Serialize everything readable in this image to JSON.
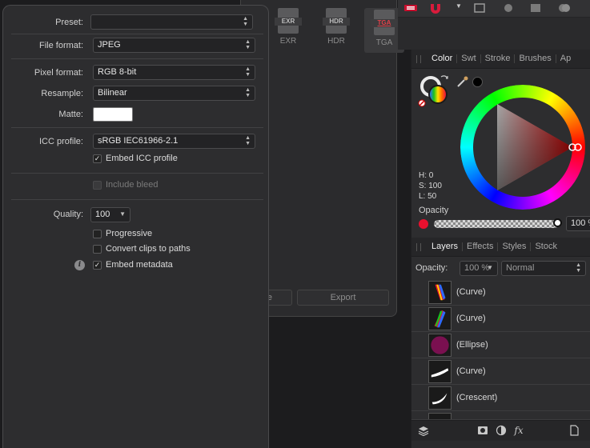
{
  "bg_dialog": {
    "formats": [
      "EXR",
      "HDR",
      "TGA"
    ],
    "selected_format": "TGA",
    "export_label": "Export",
    "partial_label": "e"
  },
  "export_dialog": {
    "preset_label": "Preset:",
    "preset_value": "",
    "file_format_label": "File format:",
    "file_format_value": "JPEG",
    "pixel_format_label": "Pixel format:",
    "pixel_format_value": "RGB 8-bit",
    "resample_label": "Resample:",
    "resample_value": "Bilinear",
    "matte_label": "Matte:",
    "icc_label": "ICC profile:",
    "icc_value": "sRGB IEC61966-2.1",
    "embed_icc_label": "Embed ICC profile",
    "include_bleed_label": "Include bleed",
    "quality_label": "Quality:",
    "quality_value": "100",
    "progressive_label": "Progressive",
    "convert_clips_label": "Convert clips to paths",
    "embed_metadata_label": "Embed metadata",
    "info_glyph": "i",
    "check_glyph": "✓"
  },
  "color_panel": {
    "tabs": [
      "Color",
      "Swt",
      "Stroke",
      "Brushes",
      "Ap"
    ],
    "h": "H: 0",
    "s": "S: 100",
    "l": "L: 50",
    "opacity_label": "Opacity",
    "opacity_value": "100 %",
    "accent": "#e8102e"
  },
  "layers_panel": {
    "tabs": [
      "Layers",
      "Effects",
      "Styles",
      "Stock"
    ],
    "opacity_label": "Opacity:",
    "opacity_value": "100 %",
    "blend_mode": "Normal",
    "layers": [
      "(Curve)",
      "(Curve)",
      "(Ellipse)",
      "(Curve)",
      "(Crescent)"
    ],
    "fx_label": "fx"
  }
}
